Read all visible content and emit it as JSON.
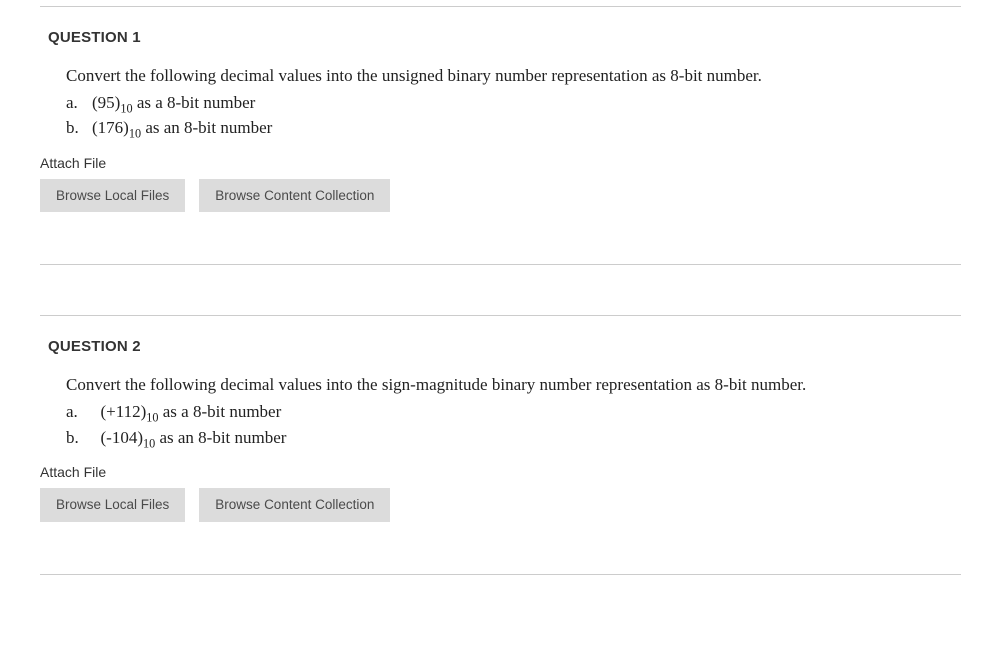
{
  "questions": [
    {
      "title": "QUESTION 1",
      "prompt": "Convert the following decimal values into the unsigned binary number representation as 8-bit number.",
      "items": [
        {
          "marker": "a.",
          "value": "(95)",
          "sub": "10",
          "rest": " as a 8-bit number"
        },
        {
          "marker": "b.",
          "value": "(176)",
          "sub": "10",
          "rest": " as an 8-bit number"
        }
      ],
      "attach_label": "Attach File",
      "buttons": {
        "browse_local": "Browse Local Files",
        "browse_content": "Browse Content Collection"
      }
    },
    {
      "title": "QUESTION 2",
      "prompt": "Convert the following decimal values into the sign-magnitude binary number representation as 8-bit number.",
      "items": [
        {
          "marker": "a.",
          "value": "(+112)",
          "sub": "10",
          "rest": " as a 8-bit number"
        },
        {
          "marker": "b.",
          "value": "(-104)",
          "sub": "10",
          "rest": " as an 8-bit number"
        }
      ],
      "attach_label": "Attach File",
      "buttons": {
        "browse_local": "Browse Local Files",
        "browse_content": "Browse Content Collection"
      }
    }
  ]
}
